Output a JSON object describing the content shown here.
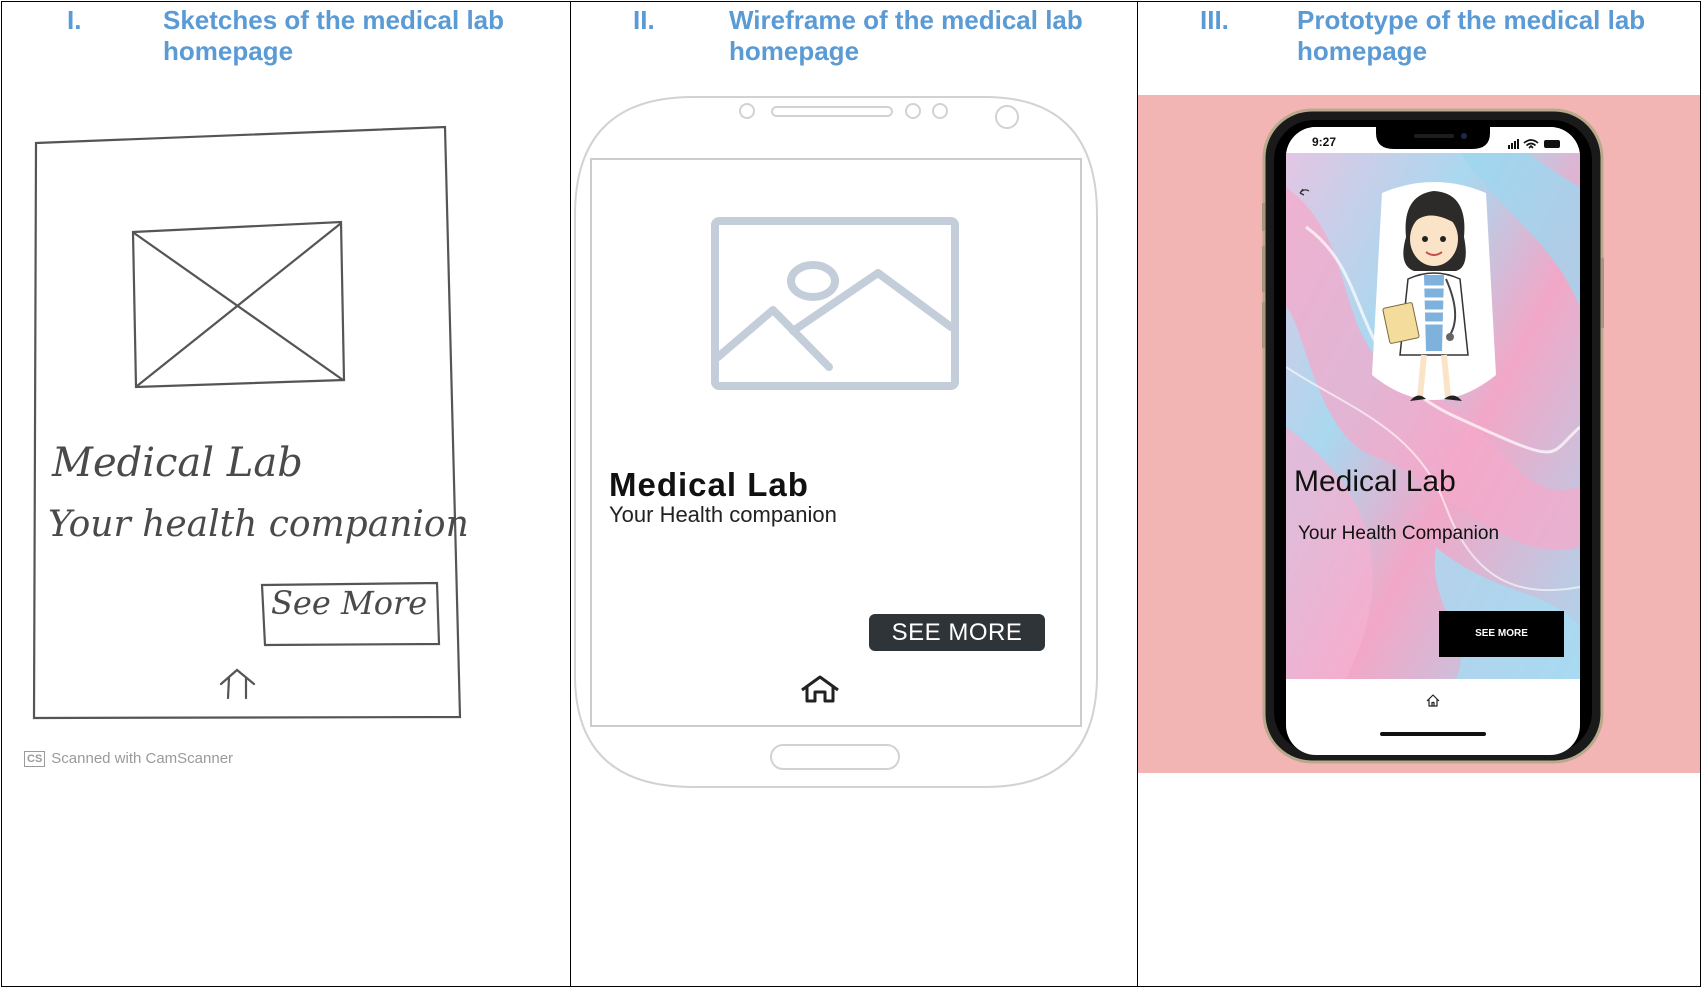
{
  "headers": [
    {
      "num": "I.",
      "title": "Sketches of the medical lab homepage"
    },
    {
      "num": "II.",
      "title": "Wireframe of the medical lab homepage"
    },
    {
      "num": "III.",
      "title": "Prototype of the medical lab homepage"
    }
  ],
  "sketch": {
    "title": "Medical Lab",
    "subtitle": "Your health companion",
    "button": "See More",
    "scanner_credit": "Scanned with CamScanner",
    "scanner_logo": "CS",
    "icons": [
      "image-placeholder-icon",
      "home-icon"
    ]
  },
  "wireframe": {
    "title": "Medical Lab",
    "subtitle": "Your Health companion",
    "button": "SEE MORE",
    "icons": [
      "image-placeholder-icon",
      "home-icon"
    ]
  },
  "prototype": {
    "status_time": "9:27",
    "title": "Medical Lab",
    "subtitle": "Your Health Companion",
    "button": "SEE MORE",
    "icons": [
      "back-icon",
      "doctor-illustration",
      "home-icon",
      "signal-icon",
      "wifi-icon",
      "battery-icon"
    ],
    "colors": {
      "background": "#f3b5b4",
      "button": "#000000",
      "marble_blue": "#a9d8ef",
      "marble_pink": "#f2a7c7"
    }
  }
}
